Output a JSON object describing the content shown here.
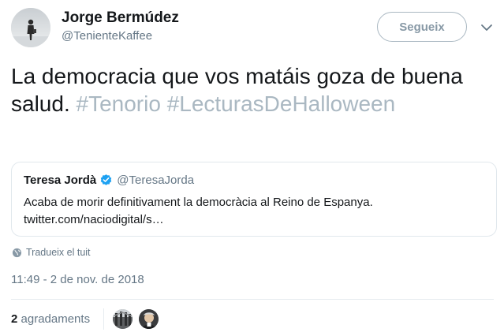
{
  "author": {
    "name": "Jorge Bermúdez",
    "handle": "@TenienteKaffee",
    "avatar_icon": "avatar-photo"
  },
  "header": {
    "follow_label": "Segueix",
    "menu_icon": "chevron-down-icon"
  },
  "tweet": {
    "text_plain": "La democracia que vos matáis goza de buena salud.",
    "hashtag_1": "#Tenorio",
    "hashtag_2": "#LecturasDeHalloween"
  },
  "quote": {
    "name": "Teresa Jordà",
    "handle": "@TeresaJorda",
    "verified": true,
    "text": "Acaba de morir definitivament la democràcia al Reino de Espanya.",
    "link": "twitter.com/naciodigital/s…"
  },
  "translate_label": "Tradueix el tuit",
  "timestamp": "11:49 - 2 de nov. de 2018",
  "likes": {
    "count": "2",
    "label": "agradaments"
  },
  "colors": {
    "text": "#14171a",
    "secondary": "#657786",
    "hashtag": "#aab8c2",
    "verified": "#1da1f2",
    "border": "#e1e8ed"
  }
}
